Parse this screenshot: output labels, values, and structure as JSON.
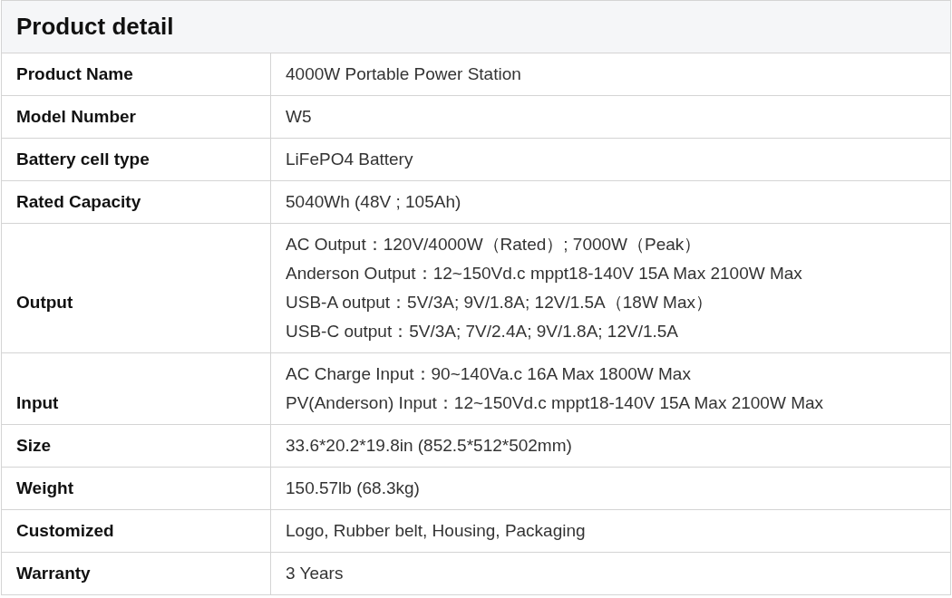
{
  "title": "Product detail",
  "rows": [
    {
      "label": "Product Name",
      "lines": [
        "4000W Portable Power Station"
      ]
    },
    {
      "label": "Model Number",
      "lines": [
        "W5"
      ]
    },
    {
      "label": "Battery cell type",
      "lines": [
        "LiFePO4 Battery"
      ]
    },
    {
      "label": "Rated Capacity",
      "lines": [
        "5040Wh (48V ; 105Ah)"
      ]
    },
    {
      "label": "Output",
      "lines": [
        "AC Output：120V/4000W（Rated）; 7000W（Peak）",
        "Anderson Output：12~150Vd.c mppt18-140V 15A Max 2100W Max",
        "USB-A output：5V/3A; 9V/1.8A; 12V/1.5A（18W Max）",
        "USB-C output：5V/3A; 7V/2.4A; 9V/1.8A; 12V/1.5A"
      ]
    },
    {
      "label": "Input",
      "lines": [
        "AC Charge Input：90~140Va.c 16A Max 1800W Max",
        "PV(Anderson) Input：12~150Vd.c mppt18-140V 15A Max 2100W Max"
      ]
    },
    {
      "label": "Size",
      "lines": [
        "33.6*20.2*19.8in (852.5*512*502mm)"
      ]
    },
    {
      "label": "Weight",
      "lines": [
        "150.57lb (68.3kg)"
      ]
    },
    {
      "label": "Customized",
      "lines": [
        "Logo, Rubber belt, Housing, Packaging"
      ]
    },
    {
      "label": "Warranty",
      "lines": [
        "3 Years"
      ]
    }
  ]
}
